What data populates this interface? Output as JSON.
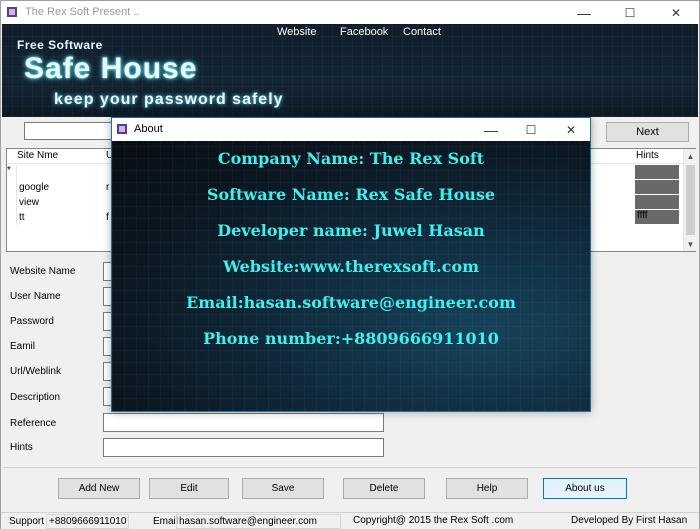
{
  "window": {
    "title": "The Rex Soft Present ..",
    "controls": {
      "minimize": "—",
      "maximize": "☐",
      "close": "✕"
    }
  },
  "banner": {
    "nav": [
      "Website",
      "Facebook",
      "Contact"
    ],
    "free_software": "Free Software",
    "brand": "Safe House",
    "tagline": "keep your password safely"
  },
  "search": {
    "value": "",
    "next_label": "Next"
  },
  "grid": {
    "columns": [
      "Site Nme",
      "U",
      "Hints"
    ],
    "rows": [
      {
        "marker": "*",
        "site": "",
        "user": "",
        "hints": ""
      },
      {
        "marker": "",
        "site": "google",
        "user": "r",
        "hints": ""
      },
      {
        "marker": "",
        "site": "view",
        "user": "",
        "hints": ""
      },
      {
        "marker": "",
        "site": "tt",
        "user": "f",
        "hints": "ffff"
      }
    ]
  },
  "form": {
    "labels": [
      "Website Name",
      "User Name",
      "Password",
      "Eamil",
      "Url/Weblink",
      "Description",
      "Reference",
      "Hints"
    ]
  },
  "buttons": [
    "Add New",
    "Edit",
    "Save",
    "Delete",
    "Help",
    "About us"
  ],
  "statusbar": {
    "support_label": "Support",
    "support_value": "+8809666911010",
    "email_label": "Email",
    "email_value": "hasan.software@engineer.com",
    "copyright": "Copyright@ 2015 the Rex Soft .com",
    "developer": "Developed By First Hasan"
  },
  "about": {
    "title": "About",
    "lines": [
      "Company Name: The Rex Soft",
      "Software Name: Rex Safe House",
      "Developer name: Juwel Hasan",
      "Website:www.therexsoft.com",
      "Email:hasan.software@engineer.com",
      "Phone number:+8809666911010"
    ]
  },
  "colors": {
    "accent_text": "#3ff0ee",
    "banner_bg": "#132434",
    "focus": "#0078d7"
  }
}
